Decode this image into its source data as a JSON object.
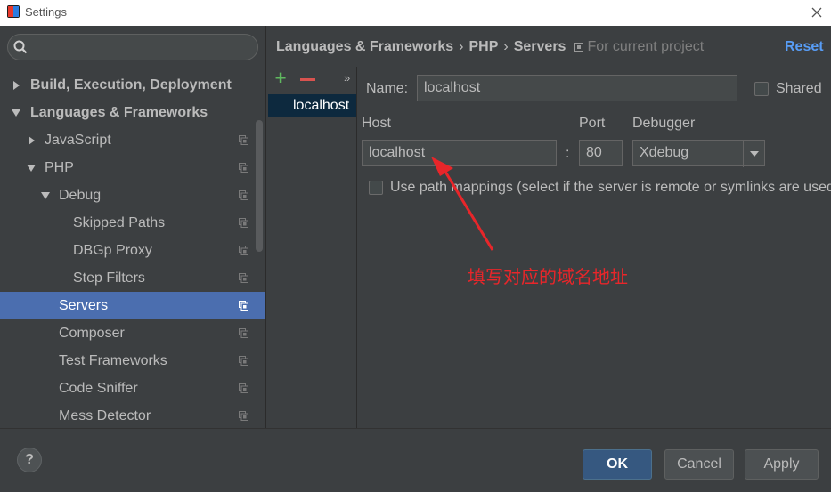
{
  "window": {
    "title": "Settings"
  },
  "search": {
    "placeholder": "",
    "value": ""
  },
  "tree": {
    "items": [
      {
        "label": "Build, Execution, Deployment",
        "expanded": false
      },
      {
        "label": "Languages & Frameworks",
        "expanded": true
      },
      {
        "label": "JavaScript",
        "expanded": false
      },
      {
        "label": "PHP",
        "expanded": true
      },
      {
        "label": "Debug",
        "expanded": true
      },
      {
        "label": "Skipped Paths"
      },
      {
        "label": "DBGp Proxy"
      },
      {
        "label": "Step Filters"
      },
      {
        "label": "Servers",
        "selected": true
      },
      {
        "label": "Composer"
      },
      {
        "label": "Test Frameworks"
      },
      {
        "label": "Code Sniffer"
      },
      {
        "label": "Mess Detector"
      }
    ]
  },
  "breadcrumb": {
    "parts": [
      "Languages & Frameworks",
      "PHP",
      "Servers"
    ],
    "separator": "›",
    "scope": "For current project"
  },
  "reset_label": "Reset",
  "servers": {
    "items": [
      "localhost"
    ],
    "more": "»"
  },
  "form": {
    "name_label": "Name:",
    "name_value": "localhost",
    "shared_label": "Shared",
    "shared_checked": false,
    "host_label": "Host",
    "host_value": "localhost",
    "colon": ":",
    "port_label": "Port",
    "port_value": "80",
    "debugger_label": "Debugger",
    "debugger_value": "Xdebug",
    "path_mappings_label": "Use path mappings (select if the server is remote or symlinks are used)",
    "path_mappings_checked": false
  },
  "annotation": {
    "text": "填写对应的域名地址",
    "color": "#e8262a"
  },
  "buttons": {
    "help": "?",
    "ok": "OK",
    "cancel": "Cancel",
    "apply": "Apply"
  },
  "colors": {
    "selection": "#4b6eaf",
    "accent_link": "#589df6",
    "default_button": "#365880"
  }
}
